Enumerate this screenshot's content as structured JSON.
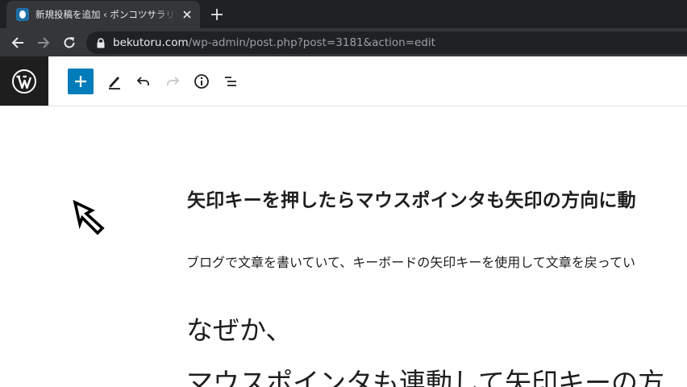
{
  "browser": {
    "tab": {
      "title": "新規投稿を追加 ‹ ポンコツサラリーマン",
      "favicon": "site-favicon",
      "close": "close-icon"
    },
    "new_tab": "plus-icon",
    "nav": {
      "back": "arrow-left-icon",
      "forward": "arrow-right-icon",
      "reload": "reload-icon"
    },
    "address": {
      "host": "bekutoru.com",
      "path": "/wp-admin/post.php?post=3181&action=edit",
      "lock": "lock-icon"
    }
  },
  "editor_toolbar": {
    "logo": "wordpress-logo",
    "add_block": "plus-icon",
    "tools": [
      "pencil-icon",
      "undo-icon",
      "redo-icon",
      "info-icon",
      "list-view-icon"
    ],
    "accent_color": "#007cba"
  },
  "content": {
    "title": "矢印キーを押したらマウスポインタも矢印の方向に動",
    "paragraph": "ブログで文章を書いていて、キーボードの矢印キーを使用して文章を戻ってい",
    "heading_line1": "なぜか、",
    "heading_line2": "マウスポインタも連動して矢印キーの方"
  },
  "cursor": "mouse-pointer-icon"
}
